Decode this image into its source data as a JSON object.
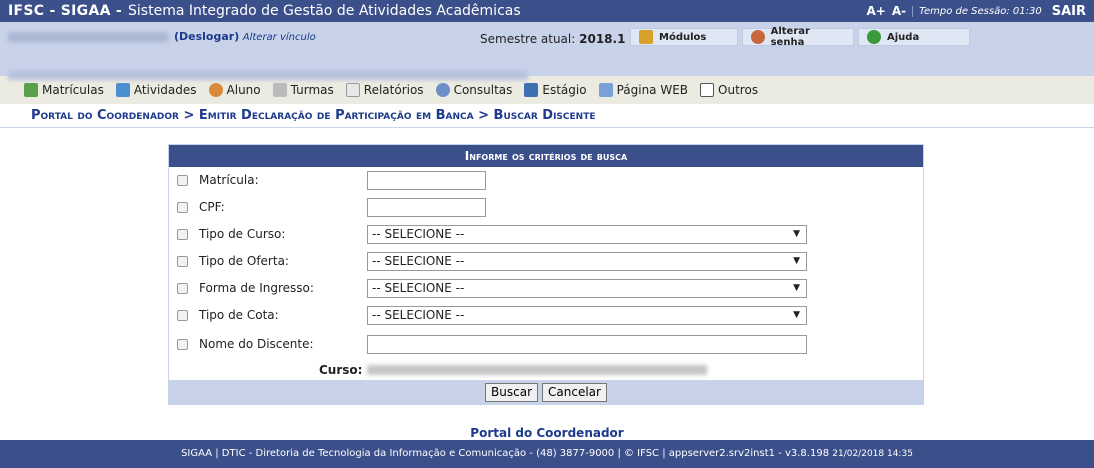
{
  "header": {
    "brand": "IFSC - SIGAA -",
    "system_name": "Sistema Integrado de Gestão de Atividades Acadêmicas",
    "font_increase": "A+",
    "font_decrease": "A-",
    "session_label": "Tempo de Sessão: 01:30",
    "logout": "SAIR"
  },
  "userbar": {
    "deslogar": "(Deslogar)",
    "alterar_vinculo": "Alterar vínculo",
    "semestre_label": "Semestre atual:",
    "semestre_value": "2018.1",
    "buttons": {
      "modulos": "Módulos",
      "alterar_senha": "Alterar senha",
      "ajuda": "Ajuda"
    }
  },
  "menu": {
    "items": [
      "Matrículas",
      "Atividades",
      "Aluno",
      "Turmas",
      "Relatórios",
      "Consultas",
      "Estágio",
      "Página WEB",
      "Outros"
    ]
  },
  "breadcrumb": "Portal do Coordenador > Emitir Declaração de Participação em Banca > Buscar Discente",
  "search": {
    "caption": "Informe os critérios de busca",
    "fields": {
      "matricula": "Matrícula:",
      "cpf": "CPF:",
      "tipo_curso": "Tipo de Curso:",
      "tipo_oferta": "Tipo de Oferta:",
      "forma_ingresso": "Forma de Ingresso:",
      "tipo_cota": "Tipo de Cota:",
      "nome_discente": "Nome do Discente:",
      "curso": "Curso:"
    },
    "select_default": "-- SELECIONE --",
    "buscar": "Buscar",
    "cancelar": "Cancelar"
  },
  "portal_link": "Portal do Coordenador",
  "footer": {
    "text": "SIGAA | DTIC - Diretoria de Tecnologia da Informação e Comunicação - (48) 3877-9000 | © IFSC | appserver2.srv2inst1 - v3.8.198",
    "timestamp": "21/02/2018 14:35"
  },
  "colors": {
    "header_bg": "#3b4f8a",
    "userbar_bg": "#c8d3ea",
    "menu_bg": "#ecebe1",
    "link": "#1d3a8c"
  }
}
